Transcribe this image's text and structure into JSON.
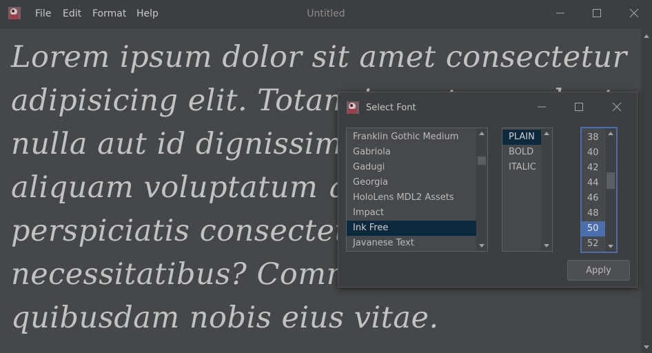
{
  "window": {
    "title": "Untitled"
  },
  "menu": [
    "File",
    "Edit",
    "Format",
    "Help"
  ],
  "editor": {
    "text": "Lorem ipsum dolor sit amet consectetur adipisicing elit. Totam inventore volupta nulla aut id dignissimos quas iusto aliquam voluptatum quidem minima perspiciatis consectetur magni necessitatibus? Commodi a rem quibusdam nobis eius vitae."
  },
  "dialog": {
    "title": "Select Font",
    "fonts": [
      "Franklin Gothic Medium",
      "Gabriola",
      "Gadugi",
      "Georgia",
      "HoloLens MDL2 Assets",
      "Impact",
      "Ink Free",
      "Javanese Text"
    ],
    "selected_font": "Ink Free",
    "styles": [
      "PLAIN",
      "BOLD",
      "ITALIC"
    ],
    "selected_style": "PLAIN",
    "sizes": [
      "38",
      "40",
      "42",
      "44",
      "46",
      "48",
      "50",
      "52"
    ],
    "selected_size": "50",
    "apply_label": "Apply"
  },
  "colors": {
    "selection_dark": "#0d293e",
    "selection_blue": "#4b6eaf",
    "background": "#3c3f41"
  }
}
